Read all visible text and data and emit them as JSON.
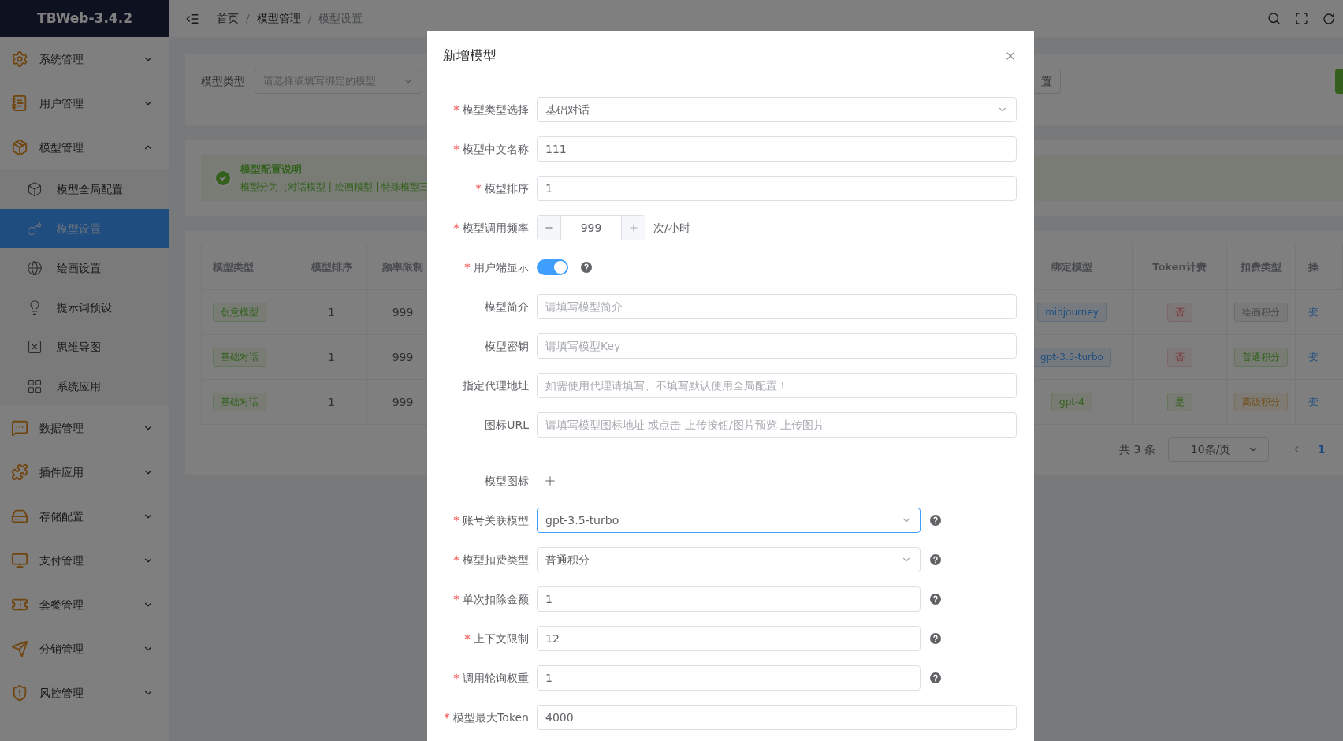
{
  "app": {
    "title": "TBWeb-3.4.2"
  },
  "sidebar": {
    "items": [
      {
        "label": "系统管理",
        "expanded": false
      },
      {
        "label": "用户管理",
        "expanded": false
      },
      {
        "label": "模型管理",
        "expanded": true,
        "children": [
          {
            "label": "模型全局配置",
            "selected": false
          },
          {
            "label": "模型设置",
            "selected": true
          },
          {
            "label": "绘画设置",
            "selected": false
          },
          {
            "label": "提示词预设",
            "selected": false
          },
          {
            "label": "思维导图",
            "selected": false
          },
          {
            "label": "系统应用",
            "selected": false
          }
        ]
      },
      {
        "label": "数据管理",
        "expanded": false
      },
      {
        "label": "插件应用",
        "expanded": false
      },
      {
        "label": "存储配置",
        "expanded": false
      },
      {
        "label": "支付管理",
        "expanded": false
      },
      {
        "label": "套餐管理",
        "expanded": false
      },
      {
        "label": "分销管理",
        "expanded": false
      },
      {
        "label": "风控管理",
        "expanded": false
      }
    ]
  },
  "breadcrumb": {
    "items": [
      "首页",
      "模型管理",
      "模型设置"
    ],
    "separator": "/"
  },
  "filter": {
    "label": "模型类型",
    "placeholder": "请选择或填写绑定的模型",
    "button": "置"
  },
  "alert": {
    "title": "模型配置说明",
    "text": "模型分为（对话模型 | 绘画模型 | 特殊模型三"
  },
  "table": {
    "columns_left": [
      "模型类型",
      "模型排序",
      "频率限制"
    ],
    "columns_right": [
      "绑定模型",
      "Token计费",
      "扣费类型",
      "操"
    ],
    "rows": [
      {
        "type": {
          "text": "创意模型",
          "kind": "success"
        },
        "order": "1",
        "limit": "999",
        "model": {
          "text": "midjourney",
          "kind": "primary"
        },
        "token": {
          "text": "否",
          "kind": "danger"
        },
        "fee": {
          "text": "绘画积分",
          "kind": "info"
        },
        "action": "变"
      },
      {
        "type": {
          "text": "基础对话",
          "kind": "success"
        },
        "order": "1",
        "limit": "999",
        "model": {
          "text": "gpt-3.5-turbo",
          "kind": "primary"
        },
        "token": {
          "text": "否",
          "kind": "danger"
        },
        "fee": {
          "text": "普通积分",
          "kind": "success"
        },
        "action": "变"
      },
      {
        "type": {
          "text": "基础对话",
          "kind": "success"
        },
        "order": "1",
        "limit": "999",
        "model": {
          "text": "gpt-4",
          "kind": "success"
        },
        "token": {
          "text": "是",
          "kind": "success"
        },
        "fee": {
          "text": "高级积分",
          "kind": "warning"
        },
        "action": "变"
      }
    ]
  },
  "pagination": {
    "total": "共 3 条",
    "page_size": "10条/页",
    "current": "1"
  },
  "dialog": {
    "title": "新增模型",
    "fields": [
      {
        "label": "模型类型选择",
        "required": true,
        "kind": "select",
        "value": "基础对话",
        "focused": false,
        "help": false
      },
      {
        "label": "模型中文名称",
        "required": true,
        "kind": "input",
        "value": "111",
        "help": false
      },
      {
        "label": "模型排序",
        "required": true,
        "kind": "input",
        "value": "1",
        "help": false
      },
      {
        "label": "模型调用频率",
        "required": true,
        "kind": "number",
        "value": "999",
        "unit": "次/小时",
        "help": false
      },
      {
        "label": "用户端显示",
        "required": true,
        "kind": "switch",
        "on": true,
        "help": true
      },
      {
        "label": "模型简介",
        "required": false,
        "kind": "input",
        "placeholder": "请填写模型简介",
        "help": false
      },
      {
        "label": "模型密钥",
        "required": false,
        "kind": "input",
        "placeholder": "请填写模型Key",
        "help": false
      },
      {
        "label": "指定代理地址",
        "required": false,
        "kind": "input",
        "placeholder": "如需使用代理请填写、不填写默认使用全局配置！",
        "help": false
      },
      {
        "label": "图标URL",
        "required": false,
        "kind": "input",
        "placeholder": "请填写模型图标地址 或点击 上传按钮/图片预览 上传图片",
        "help": false
      },
      {
        "label": "模型图标",
        "required": false,
        "kind": "upload",
        "help": false
      },
      {
        "label": "账号关联模型",
        "required": true,
        "kind": "select",
        "value": "gpt-3.5-turbo",
        "focused": true,
        "help": true
      },
      {
        "label": "模型扣费类型",
        "required": true,
        "kind": "select",
        "value": "普通积分",
        "focused": false,
        "help": true
      },
      {
        "label": "单次扣除金额",
        "required": true,
        "kind": "input",
        "value": "1",
        "help": true
      },
      {
        "label": "上下文限制",
        "required": true,
        "kind": "input",
        "value": "12",
        "help": true
      },
      {
        "label": "调用轮询权重",
        "required": true,
        "kind": "input",
        "value": "1",
        "help": true
      },
      {
        "label": "模型最大Token",
        "required": true,
        "kind": "input",
        "value": "4000",
        "help": false
      }
    ]
  }
}
